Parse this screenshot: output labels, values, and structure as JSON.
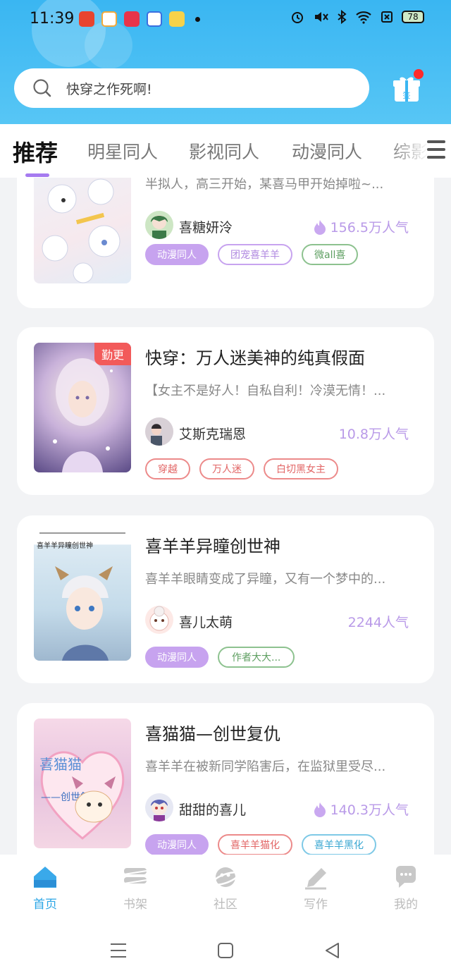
{
  "status_bar": {
    "time": "11:39",
    "battery": "78",
    "icons": [
      "alarm-icon",
      "mute-icon",
      "bluetooth-icon",
      "wifi-icon",
      "sim-icon",
      "battery-icon"
    ]
  },
  "search": {
    "placeholder": "快穿之作死啊!"
  },
  "gift": {
    "label": "签"
  },
  "tabs": [
    {
      "label": "推荐"
    },
    {
      "label": "明星同人"
    },
    {
      "label": "影视同人"
    },
    {
      "label": "动漫同人"
    },
    {
      "label": "综影"
    }
  ],
  "books": [
    {
      "title": "",
      "desc": "半拟人，高三开始，某喜马甲开始掉啦~...",
      "author": "喜糖妍泠",
      "popularity": "156.5万人气",
      "hot": true,
      "badge": "",
      "tags": [
        {
          "label": "动漫同人",
          "style": "filled"
        },
        {
          "label": "团宠喜羊羊",
          "style": "purple"
        },
        {
          "label": "微all喜",
          "style": "green"
        }
      ]
    },
    {
      "title": "快穿：万人迷美神的纯真假面",
      "desc": "【女主不是好人！自私自利！冷漠无情！...",
      "author": "艾斯克瑞恩",
      "popularity": "10.8万人气",
      "hot": false,
      "badge": "勤更",
      "tags": [
        {
          "label": "穿越",
          "style": "red"
        },
        {
          "label": "万人迷",
          "style": "red"
        },
        {
          "label": "白切黑女主",
          "style": "red"
        }
      ]
    },
    {
      "title": "喜羊羊异瞳创世神",
      "desc": "喜羊羊眼睛变成了异瞳，又有一个梦中的...",
      "author": "喜儿太萌",
      "popularity": "2244人气",
      "hot": false,
      "badge": "",
      "cover_text": "喜羊羊异瞳创世神",
      "tags": [
        {
          "label": "动漫同人",
          "style": "filled"
        },
        {
          "label": "作者大大...",
          "style": "green"
        }
      ]
    },
    {
      "title": "喜猫猫—创世复仇",
      "desc": "喜羊羊在被新同学陷害后，在监狱里受尽...",
      "author": "甜甜的喜儿",
      "popularity": "140.3万人气",
      "hot": true,
      "badge": "",
      "cover_text": "喜猫猫",
      "cover_subtext": "——创世复仇",
      "tags": [
        {
          "label": "动漫同人",
          "style": "filled"
        },
        {
          "label": "喜羊羊猫化",
          "style": "red"
        },
        {
          "label": "喜羊羊黑化",
          "style": "blue"
        }
      ]
    }
  ],
  "bottom_nav": [
    {
      "label": "首页",
      "icon": "home-icon",
      "active": true
    },
    {
      "label": "书架",
      "icon": "bookshelf-icon",
      "active": false
    },
    {
      "label": "社区",
      "icon": "community-icon",
      "active": false
    },
    {
      "label": "写作",
      "icon": "write-icon",
      "active": false
    },
    {
      "label": "我的",
      "icon": "profile-icon",
      "active": false
    }
  ],
  "colors": {
    "header": "#3ab6f2",
    "accent": "#a67bf0",
    "nav_active": "#2ba6e6",
    "popularity": "#b99ae8"
  }
}
